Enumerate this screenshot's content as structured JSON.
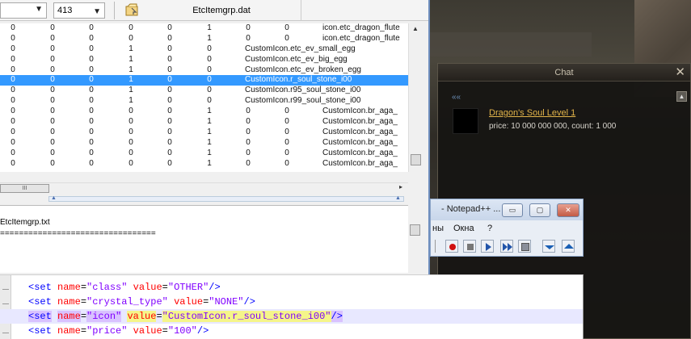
{
  "dat_editor": {
    "combo1_value": "",
    "combo2_value": "413",
    "file_title": "EtcItemgrp.dat",
    "rows": [
      {
        "v": [
          "0",
          "0",
          "0",
          "0",
          "0",
          "1",
          "0",
          "0"
        ],
        "name": "icon.etc_dragon_flute",
        "style": "a"
      },
      {
        "v": [
          "0",
          "0",
          "0",
          "0",
          "0",
          "1",
          "0",
          "0"
        ],
        "name": "icon.etc_dragon_flute",
        "style": "a"
      },
      {
        "v": [
          "0",
          "0",
          "0",
          "1",
          "0",
          "0",
          "",
          ""
        ],
        "name": "CustomIcon.etc_ev_small_egg",
        "style": "b"
      },
      {
        "v": [
          "0",
          "0",
          "0",
          "1",
          "0",
          "0",
          "",
          ""
        ],
        "name": "CustomIcon.etc_ev_big_egg",
        "style": "b"
      },
      {
        "v": [
          "0",
          "0",
          "0",
          "1",
          "0",
          "0",
          "",
          ""
        ],
        "name": "CustomIcon.etc_ev_broken_egg",
        "style": "b"
      },
      {
        "v": [
          "0",
          "0",
          "0",
          "1",
          "0",
          "0",
          "",
          ""
        ],
        "name": "CustomIcon.r_soul_stone_i00",
        "style": "b",
        "selected": true
      },
      {
        "v": [
          "0",
          "0",
          "0",
          "1",
          "0",
          "0",
          "",
          ""
        ],
        "name": "CustomIcon.r95_soul_stone_i00",
        "style": "b"
      },
      {
        "v": [
          "0",
          "0",
          "0",
          "1",
          "0",
          "0",
          "",
          ""
        ],
        "name": "CustomIcon.r99_soul_stone_i00",
        "style": "b"
      },
      {
        "v": [
          "0",
          "0",
          "0",
          "0",
          "0",
          "1",
          "0",
          "0"
        ],
        "name": "CustomIcon.br_aga_",
        "style": "a"
      },
      {
        "v": [
          "0",
          "0",
          "0",
          "0",
          "0",
          "1",
          "0",
          "0"
        ],
        "name": "CustomIcon.br_aga_",
        "style": "a"
      },
      {
        "v": [
          "0",
          "0",
          "0",
          "0",
          "0",
          "1",
          "0",
          "0"
        ],
        "name": "CustomIcon.br_aga_",
        "style": "a"
      },
      {
        "v": [
          "0",
          "0",
          "0",
          "0",
          "0",
          "1",
          "0",
          "0"
        ],
        "name": "CustomIcon.br_aga_",
        "style": "a"
      },
      {
        "v": [
          "0",
          "0",
          "0",
          "0",
          "0",
          "1",
          "0",
          "0"
        ],
        "name": "CustomIcon.br_aga_",
        "style": "a"
      },
      {
        "v": [
          "0",
          "0",
          "0",
          "0",
          "0",
          "1",
          "0",
          "0"
        ],
        "name": "CustomIcon.br_aga_",
        "style": "a"
      }
    ],
    "hscroll_grip": "III",
    "log_lines": [
      "EtcItemgrp.txt",
      "================================="
    ]
  },
  "chat": {
    "title": "Chat",
    "close": "✕",
    "tab": "««",
    "scroll_up": "▲",
    "item_name": "Dragon's Soul Level 1",
    "item_desc": "price: 10 000 000 000, count: 1 000"
  },
  "notepad": {
    "title": "- Notepad++ ...",
    "minimize": "▭",
    "maximize": "▢",
    "close": "✕",
    "menu": [
      "ны",
      "Окна",
      "?"
    ]
  },
  "code_editor": {
    "lines": [
      {
        "tag": "<set",
        "attr1": "name",
        "val1": "\"class\"",
        "attr2": "value",
        "val2": "\"OTHER\"",
        "end": "/>"
      },
      {
        "tag": "<set",
        "attr1": "name",
        "val1": "\"crystal_type\"",
        "attr2": "value",
        "val2": "\"NONE\"",
        "end": "/>"
      },
      {
        "tag": "<set",
        "attr1": "name",
        "val1": "\"icon\"",
        "attr2": "value",
        "val2": "\"CustomIcon.r_soul_stone_i00\"",
        "end": "/>",
        "highlight": true
      },
      {
        "tag": "<set",
        "attr1": "name",
        "val1": "\"price\"",
        "attr2": "value",
        "val2": "\"100\"",
        "end": "/>"
      }
    ]
  }
}
